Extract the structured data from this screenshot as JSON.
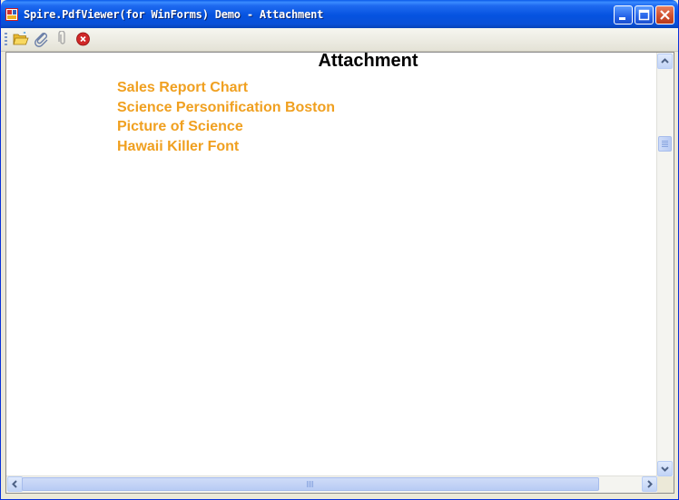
{
  "window": {
    "title": "Spire.PdfViewer(for WinForms) Demo - Attachment",
    "app_icon": "pdfviewer-app-icon",
    "controls": [
      "minimize-icon",
      "maximize-icon",
      "close-icon"
    ]
  },
  "toolbar": {
    "buttons": [
      {
        "name": "open-file-button",
        "icon": "folder-open-icon"
      },
      {
        "name": "attachment-button",
        "icon": "paperclip-icon"
      },
      {
        "name": "attachment-disabled-button",
        "icon": "paperclip-gray-icon"
      },
      {
        "name": "close-document-button",
        "icon": "red-close-icon"
      }
    ]
  },
  "document": {
    "title": "Attachment",
    "attachments": [
      "Sales Report Chart",
      "Science Personification Boston",
      "Picture of Science",
      "Hawaii Killer Font"
    ],
    "link_color": "#f0a020"
  },
  "colors": {
    "titlebar": "#0553e0",
    "window_frame": "#0831d9",
    "scrollbar_thumb": "#c2d4f6"
  }
}
